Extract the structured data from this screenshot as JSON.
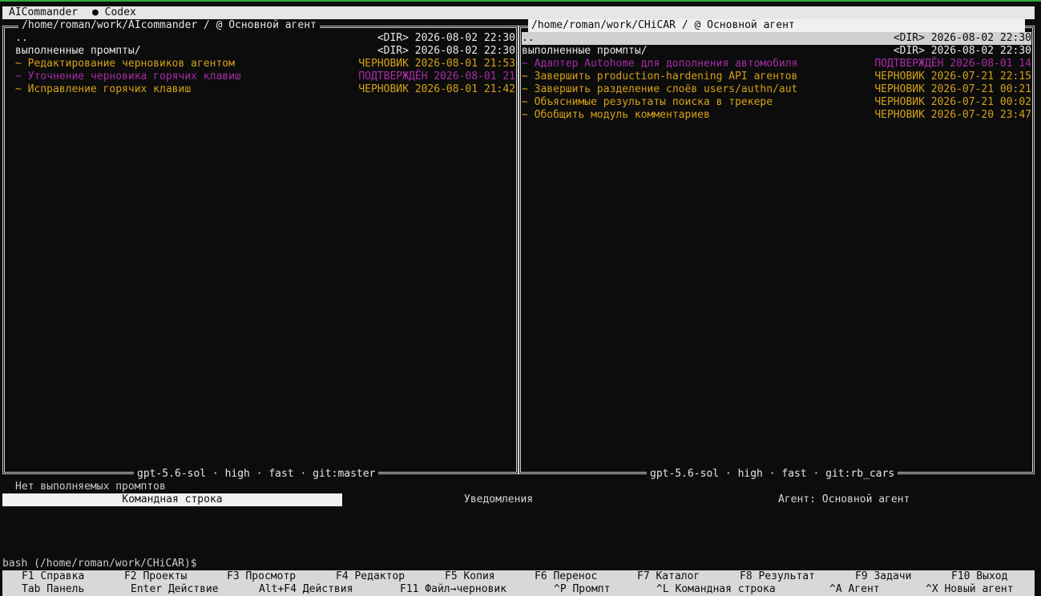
{
  "window": {
    "app_title": "AICommander",
    "tab_codex": "● Codex"
  },
  "left_panel": {
    "title": "/home/roman/work/AIcommander / @ Основной агент",
    "footer": "gpt-5.6-sol · high · fast · git:master",
    "rows": [
      {
        "name": "..",
        "meta": "<DIR> 2026-08-02 22:30",
        "kind": "dir"
      },
      {
        "name": "выполненные промпты/",
        "meta": "<DIR> 2026-08-02 22:30",
        "kind": "dir"
      },
      {
        "name": "~ Редактирование черновиков агентом",
        "meta": "ЧЕРНОВИК 2026-08-01 21:53",
        "kind": "draft"
      },
      {
        "name": "~ Уточнение черновика горячих клавиш",
        "meta": "ПОДТВЕРЖДЁН 2026-08-01 21",
        "kind": "confirmed"
      },
      {
        "name": "~ Исправление горячих клавиш",
        "meta": "ЧЕРНОВИК 2026-08-01 21:42",
        "kind": "draft"
      }
    ]
  },
  "right_panel": {
    "title": "/home/roman/work/CHiCAR / @ Основной агент",
    "footer": "gpt-5.6-sol · high · fast · git:rb_cars",
    "rows": [
      {
        "name": "..",
        "meta": "<DIR> 2026-08-02 22:30",
        "kind": "dir",
        "selected": true
      },
      {
        "name": "выполненные промпты/",
        "meta": "<DIR> 2026-08-02 22:30",
        "kind": "dir"
      },
      {
        "name": "~ Адаптер Autohome для дополнения автомобиля",
        "meta": "ПОДТВЕРЖДЁН 2026-08-01 14",
        "kind": "confirmed"
      },
      {
        "name": "~ Завершить production-hardening API агентов",
        "meta": "ЧЕРНОВИК 2026-07-21 22:15",
        "kind": "draft"
      },
      {
        "name": "~ Завершить разделение слоёв users/authn/aut",
        "meta": "ЧЕРНОВИК 2026-07-21 00:21",
        "kind": "draft"
      },
      {
        "name": "~ Объяснимые результаты поиска в трекере",
        "meta": "ЧЕРНОВИК 2026-07-21 00:02",
        "kind": "draft"
      },
      {
        "name": "~ Обобщить модуль комментариев",
        "meta": "ЧЕРНОВИК 2026-07-20 23:47",
        "kind": "draft"
      }
    ]
  },
  "status": {
    "text": "Нет выполняемых промптов"
  },
  "tabs": {
    "command_line": "Командная строка",
    "notifications": "Уведомления",
    "agent": "Агент: Основной агент"
  },
  "shell": {
    "prompt": "bash (/home/roman/work/CHiCAR)$"
  },
  "fkeys_row1": [
    "F1 Справка",
    "F2 Проекты",
    "F3 Просмотр",
    "F4 Редактор",
    "F5 Копия",
    "F6 Перенос",
    "F7 Каталог",
    "F8 Результат",
    "F9 Задачи",
    "F10 Выход"
  ],
  "fkeys_row2": [
    "Tab Панель",
    "Enter Действие",
    "Alt+F4 Действия",
    "F11 Файл→черновик",
    "^P Промпт",
    "^L Командная строка",
    "^A Агент",
    "^X Новый агент"
  ],
  "colors": {
    "draft": "#d4a017",
    "confirmed": "#a62ca6",
    "accent_green": "#2faa3a"
  }
}
